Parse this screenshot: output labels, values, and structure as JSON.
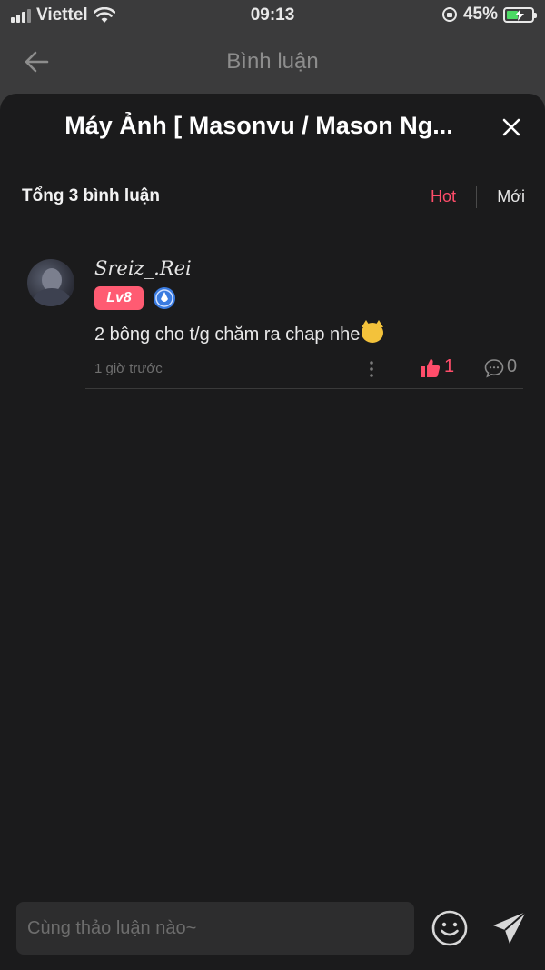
{
  "status_bar": {
    "carrier": "Viettel",
    "time": "09:13",
    "battery_percent": "45%",
    "battery_level": 0.45
  },
  "nav": {
    "title": "Bình luận",
    "back_icon": "arrow-left-icon"
  },
  "sheet": {
    "title": "Máy Ảnh [ Masonvu / Mason Ng...",
    "close_icon": "close-icon",
    "count_label": "Tổng 3 bình luận",
    "sort_options": [
      "Hot",
      "Mới"
    ],
    "active_sort": "Hot"
  },
  "comments": [
    {
      "username": "Sreiz_.Rei",
      "level": "Lv8",
      "text": "2 bông cho t/g chăm ra chap nhe",
      "time": "1 giờ trước",
      "likes": "1",
      "replies": "0"
    }
  ],
  "composer": {
    "placeholder": "Cùng thảo luận nào~",
    "emoji_icon": "smiley-icon",
    "send_icon": "send-icon"
  },
  "colors": {
    "accent": "#ff4d6a",
    "sheet_bg": "#1b1b1c",
    "badge": "#ff5b72"
  }
}
